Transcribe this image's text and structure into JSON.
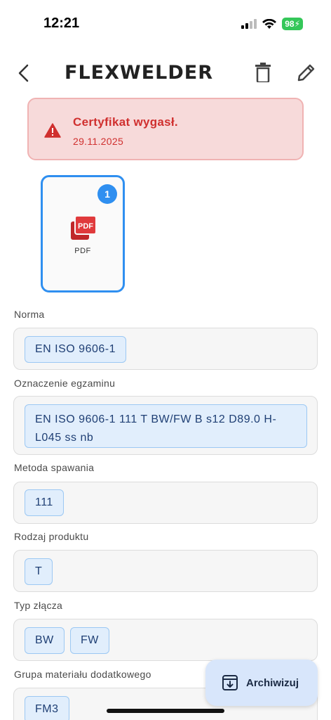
{
  "status_bar": {
    "time": "12:21",
    "battery": "98"
  },
  "header": {
    "back_icon": "chevron-left-icon",
    "logo": "FLEXWELDER",
    "delete_icon": "trash-icon",
    "edit_icon": "pencil-icon"
  },
  "alert": {
    "title": "Certyfikat wygasł.",
    "date": "29.11.2025",
    "color": "#d0302f",
    "icon": "warning-icon"
  },
  "attachment": {
    "badge": "1",
    "type_label": "PDF",
    "icon": "pdf-icon"
  },
  "fields": {
    "norma": {
      "label": "Norma",
      "chips": [
        "EN ISO 9606-1"
      ]
    },
    "oznaczenie": {
      "label": "Oznaczenie egzaminu",
      "chips": [
        "EN ISO 9606-1 111 T BW/FW B s12 D89.0 H-L045 ss nb"
      ]
    },
    "metoda": {
      "label": "Metoda spawania",
      "chips": [
        "111"
      ]
    },
    "rodzaj": {
      "label": "Rodzaj produktu",
      "chips": [
        "T"
      ]
    },
    "typ": {
      "label": "Typ złącza",
      "chips": [
        "BW",
        "FW"
      ]
    },
    "grupa": {
      "label": "Grupa materiału dodatkowego",
      "chips": [
        "FM3"
      ]
    }
  },
  "fab": {
    "label": "Archiwizuj",
    "icon": "archive-icon"
  }
}
